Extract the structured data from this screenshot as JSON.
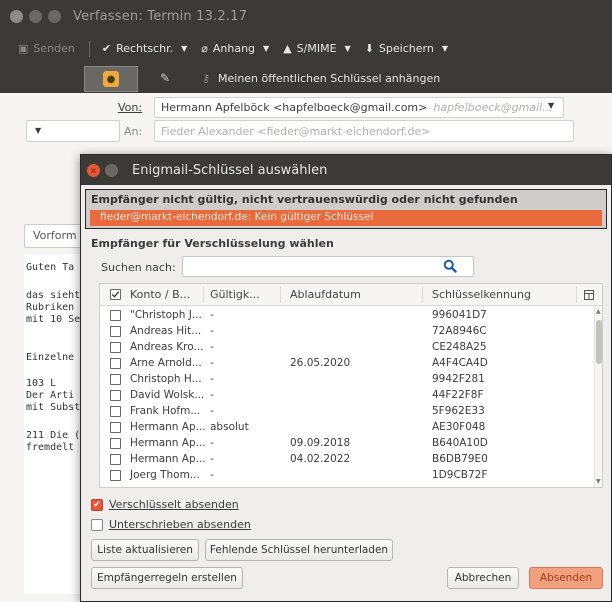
{
  "compose": {
    "title": "Verfassen: Termin 13.2.17",
    "toolbar": {
      "send": "Senden",
      "spell": "Rechtschr.",
      "attach": "Anhang",
      "smime": "S/MIME",
      "save": "Speichern"
    },
    "toolbar2": {
      "attach_key": "Meinen öffentlichen Schlüssel anhängen"
    },
    "from_label": "Von:",
    "from_value": "Hermann Apfelböck <hapfelboeck@gmail.com>",
    "from_hint": "hapfelboeck@gmail...",
    "to_label": "An:",
    "to_value": "Fieder Alexander <fieder@markt-eichendorf.de>",
    "format_select": "Vorform",
    "body_lines": [
      "Guten Ta",
      "das sieht",
      "Rubriken",
      "mit 10 Se",
      "Einzelne",
      "103    L",
      "Der Arti",
      "mit Subst",
      "211 Die (",
      "fremdelt"
    ]
  },
  "dialog": {
    "title": "Enigmail-Schlüssel auswählen",
    "warning_title": "Empfänger nicht gültig, nicht vertrauenswürdig oder nicht gefunden",
    "warning_item": "fieder@markt-eichendorf.de: Kein gültiger Schlüssel",
    "select_heading": "Empfänger für Verschlüsselung wählen",
    "search_label": "Suchen nach:",
    "search_value": "",
    "columns": {
      "account": "Konto / B...",
      "validity": "Gültigk...",
      "expiry": "Ablaufdatum",
      "keyid": "Schlüsselkennung"
    },
    "rows": [
      {
        "name": "\"Christoph J...",
        "validity": "-",
        "expiry": "",
        "keyid": "996041D7"
      },
      {
        "name": "Andreas Hit...",
        "validity": "-",
        "expiry": "",
        "keyid": "72A8946C"
      },
      {
        "name": "Andreas Kro...",
        "validity": "-",
        "expiry": "",
        "keyid": "CE248A25"
      },
      {
        "name": "Arne Arnold...",
        "validity": "-",
        "expiry": "26.05.2020",
        "keyid": "A4F4CA4D"
      },
      {
        "name": "Christoph H...",
        "validity": "-",
        "expiry": "",
        "keyid": "9942F281"
      },
      {
        "name": "David Wolsk...",
        "validity": "-",
        "expiry": "",
        "keyid": "44F22F8F"
      },
      {
        "name": "Frank Hofm...",
        "validity": "-",
        "expiry": "",
        "keyid": "5F962E33"
      },
      {
        "name": "Hermann Ap...",
        "validity": "absolut",
        "expiry": "",
        "keyid": "AE30F048"
      },
      {
        "name": "Hermann Ap...",
        "validity": "-",
        "expiry": "09.09.2018",
        "keyid": "B640A10D"
      },
      {
        "name": "Hermann Ap...",
        "validity": "-",
        "expiry": "04.02.2022",
        "keyid": "B6DB79E0"
      },
      {
        "name": "Joerg Thom...",
        "validity": "-",
        "expiry": "",
        "keyid": "1D9CB72F"
      }
    ],
    "encrypt_send": "Verschlüsselt absenden",
    "encrypt_send_checked": true,
    "sign_send": "Unterschrieben absenden",
    "sign_send_checked": false,
    "refresh_list": "Liste aktualisieren",
    "download_missing": "Fehlende Schlüssel herunterladen",
    "create_rules": "Empfängerregeln erstellen",
    "cancel": "Abbrechen",
    "send": "Absenden"
  },
  "colors": {
    "titlebar": "#3b3a37",
    "accent": "#e8563a",
    "warning_row": "#e96a3c",
    "lock": "#f0a93c"
  }
}
